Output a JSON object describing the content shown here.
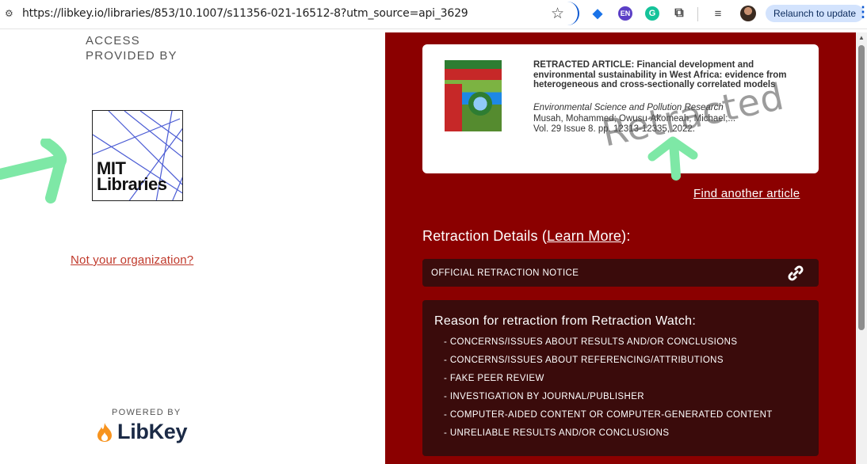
{
  "browser": {
    "url": "https://libkey.io/libraries/853/10.1007/s11356-021-16512-8?utm_source=api_3629",
    "relaunch_label": "Relaunch to update",
    "ext_en_label": "EN",
    "ext_g_label": "G"
  },
  "left_panel": {
    "access_label_line1": "ACCESS",
    "access_label_line2": "PROVIDED BY",
    "library_logo_line1": "MIT",
    "library_logo_line2": "Libraries",
    "not_org_link": "Not your organization?",
    "powered_by": "POWERED BY",
    "libkey_brand": "LibKey"
  },
  "article": {
    "title": "RETRACTED ARTICLE: Financial development and environmental sustainability in West Africa: evidence from heterogeneous and cross-sectionally correlated models",
    "journal": "Environmental Science and Pollution Research",
    "authors": "Musah, Mohammed; Owusu-Akomeah, Michael;...",
    "volume_info": "Vol. 29 Issue 8. pp. 12313-12335, 2022.",
    "stamp": "Retracted"
  },
  "find_another": "Find another article",
  "retraction": {
    "heading_prefix": "Retraction Details (",
    "learn_more": "Learn More",
    "heading_suffix": "):",
    "notice_label": "OFFICIAL RETRACTION NOTICE",
    "reason_heading": "Reason for retraction from Retraction Watch:",
    "reasons": [
      "- CONCERNS/ISSUES ABOUT RESULTS AND/OR CONCLUSIONS",
      "- CONCERNS/ISSUES ABOUT REFERENCING/ATTRIBUTIONS",
      "- FAKE PEER REVIEW",
      "- INVESTIGATION BY JOURNAL/PUBLISHER",
      "- COMPUTER-AIDED CONTENT OR COMPUTER-GENERATED CONTENT",
      "- UNRELIABLE RESULTS AND/OR CONCLUSIONS"
    ]
  },
  "colors": {
    "panel_red": "#8b0000",
    "dark_box": "#3a0b0b",
    "link_red": "#c0392b",
    "annotation_green": "#7ee8a6"
  },
  "icons": [
    "site-info-icon",
    "star-icon",
    "puzzle-icon",
    "reading-list-icon",
    "menu-icon",
    "link-icon",
    "flame-icon",
    "scroll-up-icon"
  ]
}
